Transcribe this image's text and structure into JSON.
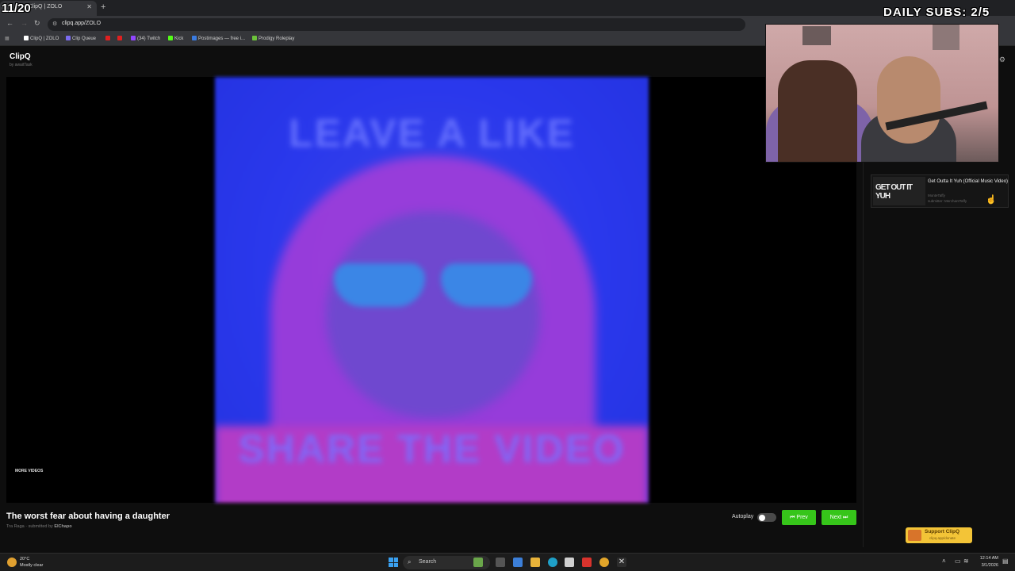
{
  "overlay": {
    "clip_counter": "11/20",
    "daily_subs": "DAILY SUBS: 2/5"
  },
  "browser": {
    "tab_title": "ClipQ | ZOLO",
    "url": "clipq.app/ZOLO",
    "bookmarks": [
      "ClipQ | ZOLO",
      "Clip Queue",
      "(34) Twitch",
      "Kick",
      "Postimages — free i...",
      "Prodigy Roleplay"
    ]
  },
  "app": {
    "title": "ClipQ",
    "byline": "by awaitTask"
  },
  "player": {
    "more_videos": "MORE VIDEOS",
    "art_top_text": "LEAVE A LIKE",
    "art_bottom_text": "SHARE THE VIDEO"
  },
  "video": {
    "title": "The worst fear about having a daughter",
    "artist": "Tra Raga",
    "submitted_prefix": "submitted by",
    "submitter": "ElChapo"
  },
  "controls": {
    "autoplay_label": "Autoplay",
    "autoplay_on": false,
    "prev_label": "⏮ Prev",
    "next_label": "Next ⏭"
  },
  "queue": [
    {
      "thumb_text": "GET OUT IT YUH",
      "title": "Get Outta It Yuh (Official Music Video)",
      "channel": "MonteTaffy",
      "submitter": "submitter: MerchantTaffy"
    }
  ],
  "support": {
    "label": "Support ClipQ",
    "url": "clipq.app/donate"
  },
  "taskbar": {
    "temp": "20°C",
    "weather": "Mostly clear",
    "search_label": "Search",
    "time": "12:14 AM",
    "date": "3/1/2026"
  },
  "colors": {
    "accent_green": "#36c51a",
    "support_yellow": "#f3c437"
  }
}
